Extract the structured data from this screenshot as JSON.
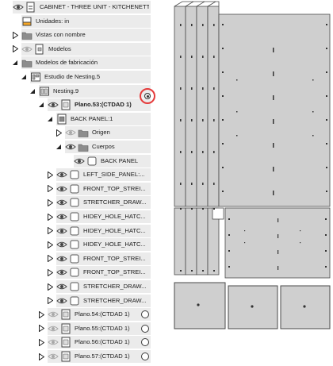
{
  "browser": {
    "rows": [
      {
        "label": "CABINET - THREE UNIT - KITCHENETTE...",
        "icon": "document-icon",
        "arrow": "none",
        "eye": true,
        "bold": false,
        "radio": "none",
        "indent": 0
      },
      {
        "label": "Unidades: in",
        "icon": "units-icon",
        "arrow": "none",
        "eye": false,
        "bold": false,
        "radio": "none",
        "indent": 1
      },
      {
        "label": "Vistas con nombre",
        "icon": "folder-icon",
        "arrow": "right",
        "eye": false,
        "bold": false,
        "radio": "none",
        "indent": 1
      },
      {
        "label": "Modelos",
        "icon": "models-icon",
        "arrow": "right",
        "eye": true,
        "eyeDim": true,
        "bold": false,
        "radio": "none",
        "indent": 1
      },
      {
        "label": "Modelos de fabricación",
        "icon": "folder-icon",
        "arrow": "down",
        "eye": false,
        "bold": false,
        "radio": "none",
        "indent": 1
      },
      {
        "label": "Estudio de Nesting.5",
        "icon": "nesting-study-icon",
        "arrow": "down",
        "eye": false,
        "bold": false,
        "radio": "none",
        "indent": 2
      },
      {
        "label": "Nesting.9",
        "icon": "nest-icon",
        "arrow": "down",
        "eye": false,
        "bold": false,
        "radio": "none",
        "indent": 3
      },
      {
        "label": "Plano.53:(CTDAD 1)",
        "icon": "sheet-icon",
        "arrow": "down",
        "eye": true,
        "bold": true,
        "radio": "highlight",
        "indent": 4
      },
      {
        "label": "BACK PANEL:1",
        "icon": "component-icon",
        "arrow": "down",
        "eye": false,
        "bold": false,
        "radio": "none",
        "indent": 5
      },
      {
        "label": "Origen",
        "icon": "folder-icon",
        "arrow": "right",
        "eye": true,
        "eyeDim": true,
        "bold": false,
        "radio": "none",
        "indent": 6
      },
      {
        "label": "Cuerpos",
        "icon": "folder-icon",
        "arrow": "down",
        "eye": true,
        "bold": false,
        "radio": "none",
        "indent": 6
      },
      {
        "label": "BACK PANEL",
        "icon": "body-icon",
        "arrow": "none",
        "eye": true,
        "bold": false,
        "radio": "none",
        "indent": 7
      },
      {
        "label": "LEFT_SIDE_PANEL:...",
        "icon": "body-icon",
        "arrow": "right",
        "eye": true,
        "bold": false,
        "radio": "none",
        "indent": 5
      },
      {
        "label": "FRONT_TOP_STREI...",
        "icon": "body-icon",
        "arrow": "right",
        "eye": true,
        "bold": false,
        "radio": "none",
        "indent": 5
      },
      {
        "label": "STRETCHER_DRAW...",
        "icon": "body-icon",
        "arrow": "right",
        "eye": true,
        "bold": false,
        "radio": "none",
        "indent": 5
      },
      {
        "label": "HIDEY_HOLE_HATC...",
        "icon": "body-icon",
        "arrow": "right",
        "eye": true,
        "bold": false,
        "radio": "none",
        "indent": 5
      },
      {
        "label": "HIDEY_HOLE_HATC...",
        "icon": "body-icon",
        "arrow": "right",
        "eye": true,
        "bold": false,
        "radio": "none",
        "indent": 5
      },
      {
        "label": "HIDEY_HOLE_HATC...",
        "icon": "body-icon",
        "arrow": "right",
        "eye": true,
        "bold": false,
        "radio": "none",
        "indent": 5
      },
      {
        "label": "FRONT_TOP_STREI...",
        "icon": "body-icon",
        "arrow": "right",
        "eye": true,
        "bold": false,
        "radio": "none",
        "indent": 5
      },
      {
        "label": "FRONT_TOP_STREI...",
        "icon": "body-icon",
        "arrow": "right",
        "eye": true,
        "bold": false,
        "radio": "none",
        "indent": 5
      },
      {
        "label": "STRETCHER_DRAW...",
        "icon": "body-icon",
        "arrow": "right",
        "eye": true,
        "bold": false,
        "radio": "none",
        "indent": 5
      },
      {
        "label": "STRETCHER_DRAW...",
        "icon": "body-icon",
        "arrow": "right",
        "eye": true,
        "bold": false,
        "radio": "none",
        "indent": 5
      },
      {
        "label": "Plano.54:(CTDAD 1)",
        "icon": "sheet-icon",
        "arrow": "right",
        "eye": true,
        "eyeDim": true,
        "bold": false,
        "radio": "off",
        "indent": 4
      },
      {
        "label": "Plano.55:(CTDAD 1)",
        "icon": "sheet-icon",
        "arrow": "right",
        "eye": true,
        "eyeDim": true,
        "bold": false,
        "radio": "off",
        "indent": 4
      },
      {
        "label": "Plano.56:(CTDAD 1)",
        "icon": "sheet-icon",
        "arrow": "right",
        "eye": true,
        "eyeDim": true,
        "bold": false,
        "radio": "off",
        "indent": 4
      },
      {
        "label": "Plano.57:(CTDAD 1)",
        "icon": "sheet-icon",
        "arrow": "right",
        "eye": true,
        "eyeDim": true,
        "bold": false,
        "radio": "off",
        "indent": 4
      }
    ]
  },
  "colors": {
    "panel_fill": "#d0d0d0",
    "panel_stroke": "#4a4a4a",
    "highlight_ring": "#e53b3b",
    "row_bg": "#ebebeb"
  }
}
